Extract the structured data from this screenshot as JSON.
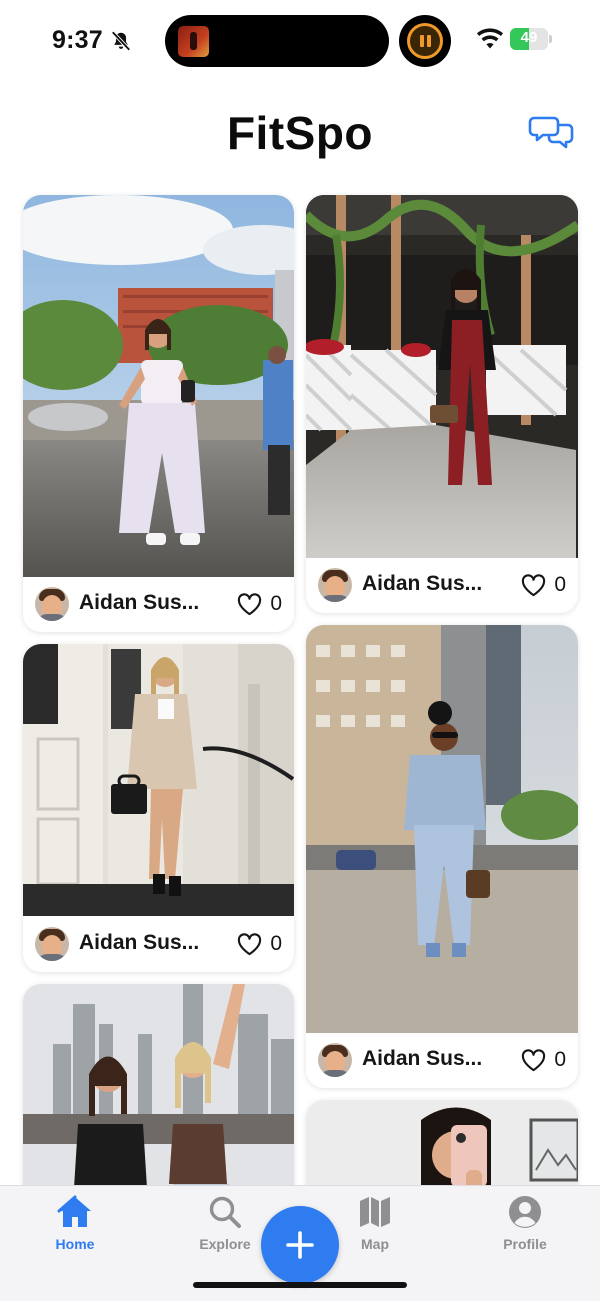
{
  "status_bar": {
    "time": "9:37",
    "battery_level": "49",
    "battery_percent": 49,
    "icons": [
      "bell-slash-icon",
      "album-art-thumbnail",
      "timer-pause-icon",
      "wifi-icon",
      "battery-charging-icon"
    ]
  },
  "header": {
    "title": "FitSpo",
    "messages_icon": "chat-bubbles-icon"
  },
  "feed": {
    "posts": [
      {
        "user": "Aidan Sus...",
        "likes": "0",
        "scene": "Woman in white corset top and white cargo pants at a city park fountain"
      },
      {
        "user": "Aidan Sus...",
        "likes": "0",
        "scene": "Woman in burgundy jumpsuit and black leather jacket outside a restaurant with lattice fence"
      },
      {
        "user": "Aidan Sus...",
        "likes": "0",
        "scene": "Woman in beige blazer and shorts on white building steps"
      },
      {
        "user": "Aidan Sus...",
        "likes": "0",
        "scene": "Woman in double denim outfit crossing a city street"
      },
      {
        "user": "",
        "likes": "",
        "scene": "Two women posing in front of the Manhattan skyline"
      },
      {
        "user": "",
        "likes": "",
        "scene": "Mirror selfie with phone"
      }
    ]
  },
  "tab_bar": {
    "tabs": [
      {
        "label": "Home",
        "icon": "house-icon",
        "active": true
      },
      {
        "label": "Explore",
        "icon": "magnifying-glass-icon",
        "active": false
      },
      {
        "label": "Map",
        "icon": "map-icon",
        "active": false
      },
      {
        "label": "Profile",
        "icon": "person-circle-icon",
        "active": false
      }
    ],
    "create_icon": "plus-icon"
  },
  "colors": {
    "accent": "#2f7bf0",
    "inactive_tab": "#8e8e93",
    "battery_green": "#34c759",
    "timer_orange": "#f09a2a"
  }
}
